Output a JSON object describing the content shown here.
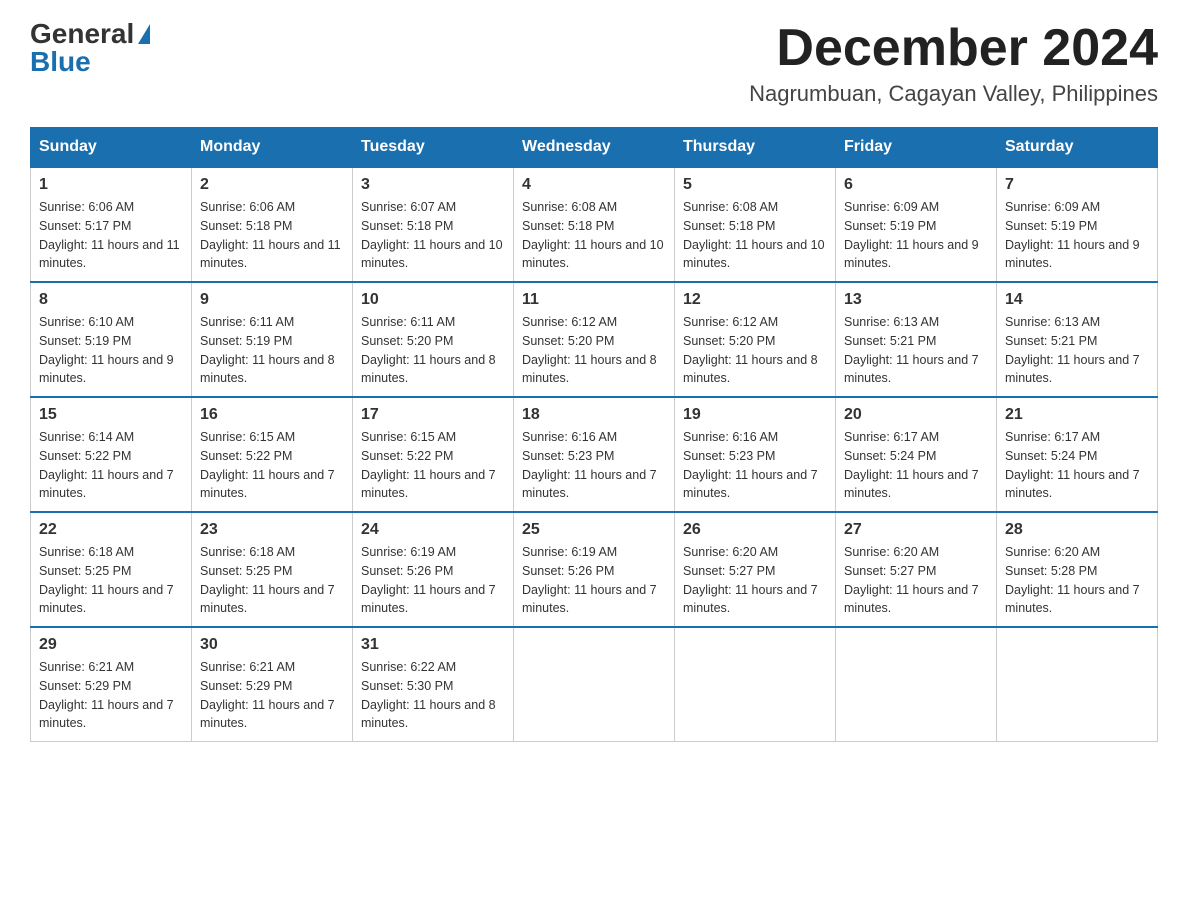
{
  "header": {
    "logo_general": "General",
    "logo_blue": "Blue",
    "month_title": "December 2024",
    "subtitle": "Nagrumbuan, Cagayan Valley, Philippines"
  },
  "days_of_week": [
    "Sunday",
    "Monday",
    "Tuesday",
    "Wednesday",
    "Thursday",
    "Friday",
    "Saturday"
  ],
  "weeks": [
    [
      {
        "day": 1,
        "sunrise": "6:06 AM",
        "sunset": "5:17 PM",
        "daylight": "11 hours and 11 minutes."
      },
      {
        "day": 2,
        "sunrise": "6:06 AM",
        "sunset": "5:18 PM",
        "daylight": "11 hours and 11 minutes."
      },
      {
        "day": 3,
        "sunrise": "6:07 AM",
        "sunset": "5:18 PM",
        "daylight": "11 hours and 10 minutes."
      },
      {
        "day": 4,
        "sunrise": "6:08 AM",
        "sunset": "5:18 PM",
        "daylight": "11 hours and 10 minutes."
      },
      {
        "day": 5,
        "sunrise": "6:08 AM",
        "sunset": "5:18 PM",
        "daylight": "11 hours and 10 minutes."
      },
      {
        "day": 6,
        "sunrise": "6:09 AM",
        "sunset": "5:19 PM",
        "daylight": "11 hours and 9 minutes."
      },
      {
        "day": 7,
        "sunrise": "6:09 AM",
        "sunset": "5:19 PM",
        "daylight": "11 hours and 9 minutes."
      }
    ],
    [
      {
        "day": 8,
        "sunrise": "6:10 AM",
        "sunset": "5:19 PM",
        "daylight": "11 hours and 9 minutes."
      },
      {
        "day": 9,
        "sunrise": "6:11 AM",
        "sunset": "5:19 PM",
        "daylight": "11 hours and 8 minutes."
      },
      {
        "day": 10,
        "sunrise": "6:11 AM",
        "sunset": "5:20 PM",
        "daylight": "11 hours and 8 minutes."
      },
      {
        "day": 11,
        "sunrise": "6:12 AM",
        "sunset": "5:20 PM",
        "daylight": "11 hours and 8 minutes."
      },
      {
        "day": 12,
        "sunrise": "6:12 AM",
        "sunset": "5:20 PM",
        "daylight": "11 hours and 8 minutes."
      },
      {
        "day": 13,
        "sunrise": "6:13 AM",
        "sunset": "5:21 PM",
        "daylight": "11 hours and 7 minutes."
      },
      {
        "day": 14,
        "sunrise": "6:13 AM",
        "sunset": "5:21 PM",
        "daylight": "11 hours and 7 minutes."
      }
    ],
    [
      {
        "day": 15,
        "sunrise": "6:14 AM",
        "sunset": "5:22 PM",
        "daylight": "11 hours and 7 minutes."
      },
      {
        "day": 16,
        "sunrise": "6:15 AM",
        "sunset": "5:22 PM",
        "daylight": "11 hours and 7 minutes."
      },
      {
        "day": 17,
        "sunrise": "6:15 AM",
        "sunset": "5:22 PM",
        "daylight": "11 hours and 7 minutes."
      },
      {
        "day": 18,
        "sunrise": "6:16 AM",
        "sunset": "5:23 PM",
        "daylight": "11 hours and 7 minutes."
      },
      {
        "day": 19,
        "sunrise": "6:16 AM",
        "sunset": "5:23 PM",
        "daylight": "11 hours and 7 minutes."
      },
      {
        "day": 20,
        "sunrise": "6:17 AM",
        "sunset": "5:24 PM",
        "daylight": "11 hours and 7 minutes."
      },
      {
        "day": 21,
        "sunrise": "6:17 AM",
        "sunset": "5:24 PM",
        "daylight": "11 hours and 7 minutes."
      }
    ],
    [
      {
        "day": 22,
        "sunrise": "6:18 AM",
        "sunset": "5:25 PM",
        "daylight": "11 hours and 7 minutes."
      },
      {
        "day": 23,
        "sunrise": "6:18 AM",
        "sunset": "5:25 PM",
        "daylight": "11 hours and 7 minutes."
      },
      {
        "day": 24,
        "sunrise": "6:19 AM",
        "sunset": "5:26 PM",
        "daylight": "11 hours and 7 minutes."
      },
      {
        "day": 25,
        "sunrise": "6:19 AM",
        "sunset": "5:26 PM",
        "daylight": "11 hours and 7 minutes."
      },
      {
        "day": 26,
        "sunrise": "6:20 AM",
        "sunset": "5:27 PM",
        "daylight": "11 hours and 7 minutes."
      },
      {
        "day": 27,
        "sunrise": "6:20 AM",
        "sunset": "5:27 PM",
        "daylight": "11 hours and 7 minutes."
      },
      {
        "day": 28,
        "sunrise": "6:20 AM",
        "sunset": "5:28 PM",
        "daylight": "11 hours and 7 minutes."
      }
    ],
    [
      {
        "day": 29,
        "sunrise": "6:21 AM",
        "sunset": "5:29 PM",
        "daylight": "11 hours and 7 minutes."
      },
      {
        "day": 30,
        "sunrise": "6:21 AM",
        "sunset": "5:29 PM",
        "daylight": "11 hours and 7 minutes."
      },
      {
        "day": 31,
        "sunrise": "6:22 AM",
        "sunset": "5:30 PM",
        "daylight": "11 hours and 8 minutes."
      },
      null,
      null,
      null,
      null
    ]
  ]
}
